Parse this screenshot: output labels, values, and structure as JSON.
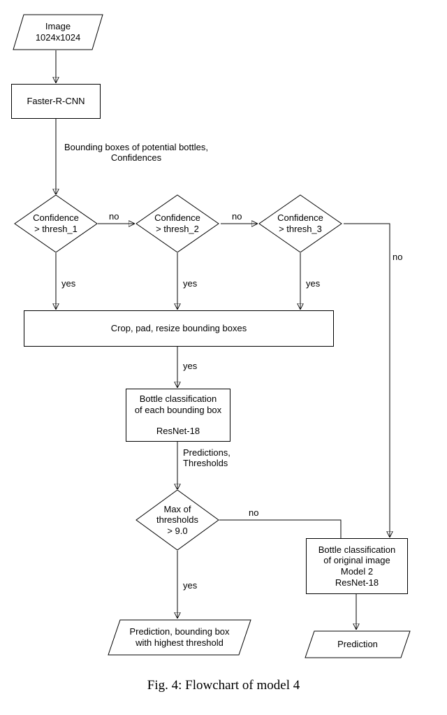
{
  "nodes": {
    "input": {
      "line1": "Image",
      "line2": "1024x1024"
    },
    "frcnn": {
      "line1": "Faster-R-CNN"
    },
    "bb_label": {
      "line1": "Bounding boxes of potential bottles,",
      "line2": "Confidences"
    },
    "d1": {
      "line1": "Confidence",
      "line2": "> thresh_1"
    },
    "d2": {
      "line1": "Confidence",
      "line2": "> thresh_2"
    },
    "d3": {
      "line1": "Confidence",
      "line2": "> thresh_3"
    },
    "crop": {
      "line1": "Crop, pad, resize bounding boxes"
    },
    "cls_bbox": {
      "line1": "Bottle classification",
      "line2": "of each bounding box",
      "line3": "ResNet-18"
    },
    "pred_thresh_label": {
      "line1": "Predictions,",
      "line2": "Thresholds"
    },
    "d4": {
      "line1": "Max of",
      "line2": "thresholds",
      "line3": "> 9.0"
    },
    "cls_orig": {
      "line1": "Bottle classification",
      "line2": "of original image",
      "line3": "Model 2",
      "line4": "ResNet-18"
    },
    "out_left": {
      "line1": "Prediction, bounding box",
      "line2": "with highest threshold"
    },
    "out_right": {
      "line1": "Prediction"
    }
  },
  "labels": {
    "yes": "yes",
    "no": "no"
  },
  "caption": "Fig. 4: Flowchart of model 4"
}
